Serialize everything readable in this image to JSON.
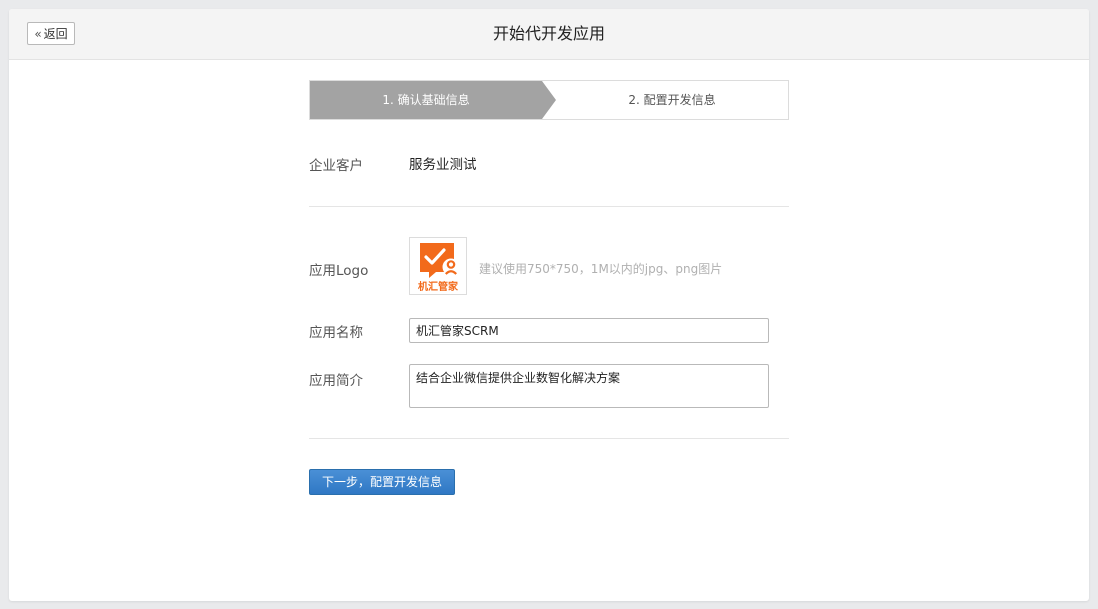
{
  "header": {
    "back_label": "返回",
    "title": "开始代开发应用"
  },
  "steps": [
    {
      "label": "1. 确认基础信息",
      "active": true
    },
    {
      "label": "2. 配置开发信息",
      "active": false
    }
  ],
  "form": {
    "customer": {
      "label": "企业客户",
      "value": "服务业测试"
    },
    "logo": {
      "label": "应用Logo",
      "hint": "建议使用750*750，1M以内的jpg、png图片",
      "logo_text": "机汇管家",
      "brand_color": "#f26a1b"
    },
    "name": {
      "label": "应用名称",
      "value": "机汇管家SCRM"
    },
    "intro": {
      "label": "应用简介",
      "value": "结合企业微信提供企业数智化解决方案"
    }
  },
  "actions": {
    "next_label": "下一步，配置开发信息"
  },
  "colors": {
    "accent": "#2f78c4",
    "step_active": "#a3a3a3"
  },
  "icons": {
    "back": "double-chevron-left-icon"
  }
}
